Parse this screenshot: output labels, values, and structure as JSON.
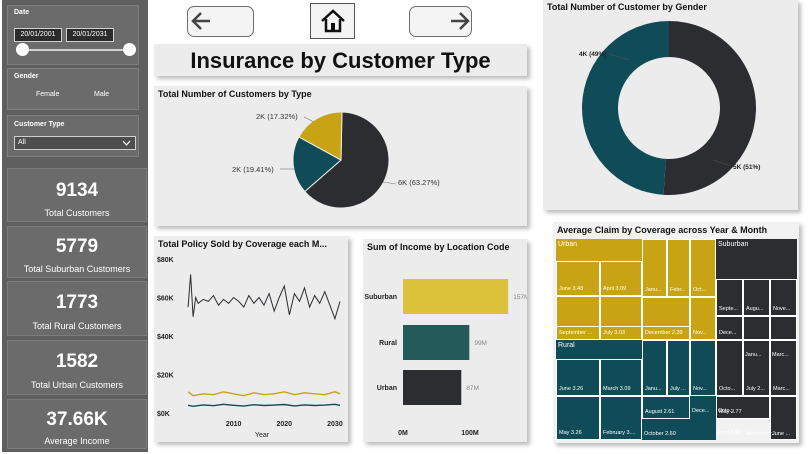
{
  "nav": {
    "back_icon": "arrow-left-icon",
    "home_icon": "home-icon",
    "forward_icon": "arrow-right-icon"
  },
  "page_title": "Insurance by Customer Type",
  "slicers": {
    "date": {
      "title": "Date",
      "start": "20/01/2001",
      "end": "20/01/2031"
    },
    "gender": {
      "title": "Gender",
      "options": [
        "Female",
        "Male"
      ]
    },
    "customer_type": {
      "title": "Customer Type",
      "selected": "All"
    }
  },
  "kpis": [
    {
      "value": "9134",
      "label": "Total Customers"
    },
    {
      "value": "5779",
      "label": "Total Suburban Customers"
    },
    {
      "value": "1773",
      "label": "Total Rural Customers"
    },
    {
      "value": "1582",
      "label": "Total Urban Customers"
    },
    {
      "value": "37.66K",
      "label": "Average Income"
    }
  ],
  "colors": {
    "black": "#2b2d31",
    "teal": "#0f4c57",
    "gold": "#c8a415",
    "suburban_bar": "#dcc23b",
    "rural_bar": "#245a5a"
  },
  "chart_data": [
    {
      "type": "pie",
      "title": "Total Number of Customers by Type",
      "slices": [
        {
          "label": "6K (63.27%)",
          "value": 63.27
        },
        {
          "label": "2K (19.41%)",
          "value": 19.41
        },
        {
          "label": "2K (17.32%)",
          "value": 17.32
        }
      ]
    },
    {
      "type": "pie",
      "title": "Total Number of Customer by Gender",
      "slices": [
        {
          "label": "5K (51%)",
          "value": 51
        },
        {
          "label": "4K (49%)",
          "value": 49
        }
      ]
    },
    {
      "type": "line",
      "title": "Total Policy Sold by Coverage each M...",
      "xlabel": "Year",
      "x_ticks": [
        "2010",
        "2020",
        "2030"
      ],
      "y_ticks": [
        "$80K",
        "$60K",
        "$40K",
        "$20K",
        "$0K"
      ],
      "xlim": [
        2000,
        2031
      ],
      "ylim": [
        0,
        80000
      ],
      "series": [
        {
          "x": [
            2001,
            2001.5,
            2002,
            2002.5,
            2003,
            2004,
            2005,
            2006,
            2007,
            2008,
            2009,
            2010,
            2011,
            2012,
            2013,
            2014,
            2015,
            2016,
            2017,
            2018,
            2019,
            2020,
            2021,
            2022,
            2023,
            2024,
            2025,
            2026,
            2027,
            2028,
            2029,
            2030,
            2031
          ],
          "values": [
            55000,
            72000,
            50000,
            60000,
            57000,
            59000,
            58000,
            61000,
            56000,
            59000,
            57000,
            60000,
            58000,
            55000,
            61000,
            57000,
            60000,
            56000,
            62000,
            53000,
            60000,
            66000,
            51000,
            62000,
            58000,
            65000,
            55000,
            61000,
            57000,
            63000,
            56000,
            49000,
            58000
          ]
        },
        {
          "x": [
            2001,
            2002,
            2004,
            2006,
            2008,
            2010,
            2012,
            2014,
            2016,
            2018,
            2020,
            2022,
            2024,
            2026,
            2028,
            2030,
            2031
          ],
          "values": [
            11000,
            9000,
            10000,
            9500,
            11000,
            10000,
            9000,
            10500,
            9500,
            10000,
            11000,
            9500,
            10500,
            10000,
            9500,
            11000,
            10000
          ]
        },
        {
          "x": [
            2001,
            2002,
            2004,
            2006,
            2008,
            2010,
            2012,
            2014,
            2016,
            2018,
            2020,
            2022,
            2024,
            2026,
            2028,
            2030,
            2031
          ],
          "values": [
            4000,
            3500,
            4200,
            3800,
            4500,
            4000,
            3600,
            4300,
            3900,
            4100,
            4400,
            3700,
            4200,
            3900,
            4100,
            4500,
            4000
          ]
        }
      ]
    },
    {
      "type": "bar",
      "title": "Sum of Income by Location Code",
      "categories": [
        "Suburban",
        "Rural",
        "Urban"
      ],
      "values": [
        157,
        99,
        87
      ],
      "value_labels": [
        "157M",
        "99M",
        "87M"
      ],
      "x_ticks": [
        "0M",
        "100M"
      ],
      "xlim": [
        0,
        100
      ]
    },
    {
      "type": "heatmap",
      "title": "Average Claim by Coverage across Year & Month",
      "groups": [
        "Urban",
        "Suburban",
        "Rural"
      ],
      "labels": [
        "June 3.48",
        "April 3.09",
        "March 3.28",
        "May 3.06",
        "Janu...",
        "Febr...",
        "Oct...",
        "August 2.82",
        "September ...",
        "July 3.03",
        "December 2.39",
        "Nov...",
        "Septe...",
        "Augu...",
        "Nove...",
        "Dece...",
        "Octo...",
        "Janu...",
        "June 3.26",
        "March 3.09",
        "Janu...",
        "July ...",
        "Nov...",
        "Octo...",
        "July 2...",
        "Marc...",
        "May 3.26",
        "February 3....",
        "August 2.61",
        "May 2.77",
        "April 3.12",
        "September...",
        "October 2.60",
        "Dece...",
        "August 2.73",
        "June ..."
      ]
    }
  ]
}
